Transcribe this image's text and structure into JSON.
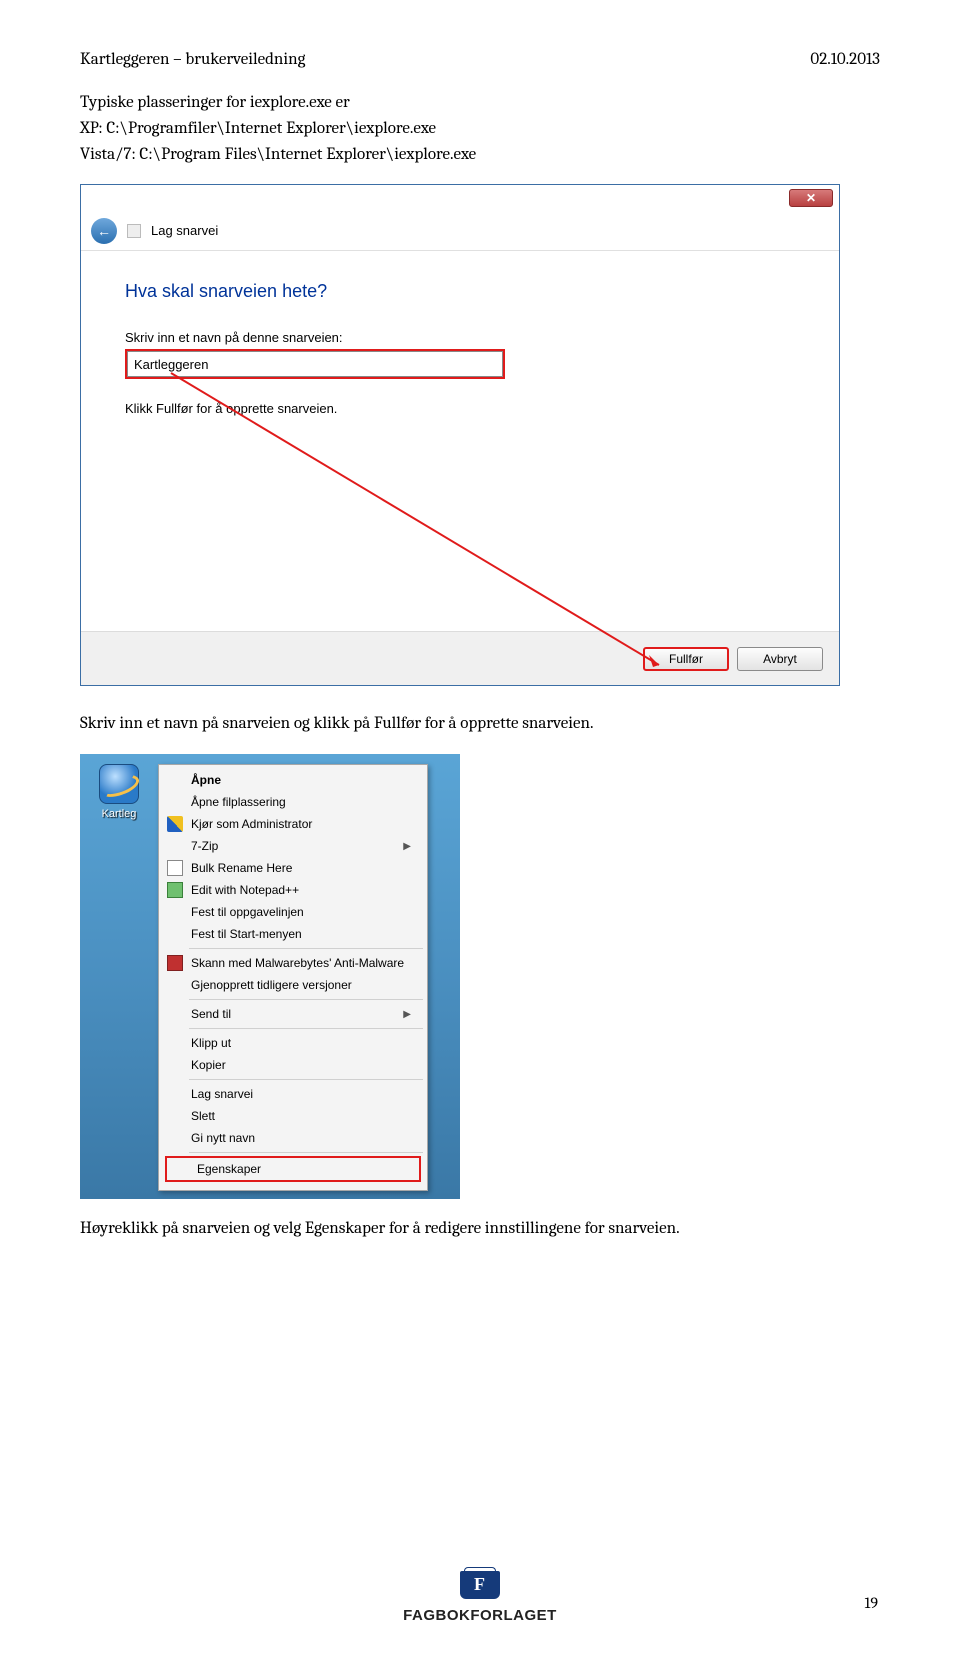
{
  "header": {
    "left": "Kartleggeren – brukerveiledning",
    "right": "02.10.2013"
  },
  "intro": {
    "l1": "Typiske plasseringer for iexplore.exe er",
    "l2": "XP: C:\\Programfiler\\Internet Explorer\\iexplore.exe",
    "l3": "Vista/7: C:\\Program Files\\Internet Explorer\\iexplore.exe"
  },
  "wizard": {
    "nav_label": "Lag snarvei",
    "heading": "Hva skal snarveien hete?",
    "field_label": "Skriv inn et navn på denne snarveien:",
    "input_value": "Kartleggeren",
    "instruction": "Klikk Fullfør for å opprette snarveien.",
    "btn_finish": "Fullfør",
    "btn_cancel": "Avbryt"
  },
  "mid_text": "Skriv inn et navn på snarveien og klikk på Fullfør for å opprette snarveien.",
  "desktop_icon_label": "Kartleg",
  "context_menu": {
    "items": [
      {
        "label": "Åpne",
        "bold": true
      },
      {
        "label": "Åpne filplassering"
      },
      {
        "label": "Kjør som Administrator",
        "icon": "shield"
      },
      {
        "label": "7-Zip",
        "arrow": true
      },
      {
        "label": "Bulk Rename Here",
        "icon": "doc"
      },
      {
        "label": "Edit with Notepad++",
        "icon": "np"
      },
      {
        "label": "Fest til oppgavelinjen"
      },
      {
        "label": "Fest til Start-menyen"
      }
    ],
    "items2": [
      {
        "label": "Skann med Malwarebytes' Anti-Malware",
        "icon": "mb"
      },
      {
        "label": "Gjenopprett tidligere versjoner"
      }
    ],
    "items3": [
      {
        "label": "Send til",
        "arrow": true
      }
    ],
    "items4": [
      {
        "label": "Klipp ut"
      },
      {
        "label": "Kopier"
      }
    ],
    "items5": [
      {
        "label": "Lag snarvei"
      },
      {
        "label": "Slett"
      },
      {
        "label": "Gi nytt navn"
      }
    ],
    "highlighted": "Egenskaper"
  },
  "bottom_text": "Høyreklikk på snarveien og velg Egenskaper for å redigere innstillingene for snarveien.",
  "footer": {
    "brand": "FAGBOKFORLAGET",
    "page": "19"
  }
}
